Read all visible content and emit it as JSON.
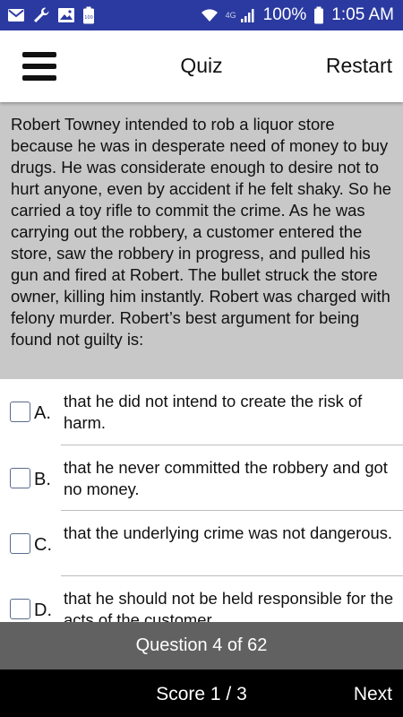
{
  "status_bar": {
    "network_label": "4G",
    "battery": "100%",
    "time": "1:05 AM",
    "icons": [
      "mail-icon",
      "wrench-icon",
      "image-icon",
      "battery-full-icon",
      "wifi-icon",
      "signal-icon",
      "battery-icon"
    ]
  },
  "header": {
    "title": "Quiz",
    "restart_label": "Restart",
    "menu_icon": "hamburger-menu-icon"
  },
  "question": {
    "text": "Robert Towney intended to rob a liquor store because he was in desperate need of money to buy drugs. He was considerate enough to desire not to hurt anyone, even by accident if he felt shaky. So he carried a toy rifle to commit the crime. As he was carrying out the robbery, a customer entered the store, saw the robbery in progress, and pulled his gun and fired at Robert. The bullet struck the store owner, killing him instantly. Robert was charged with felony murder. Robert’s best argument for being found not guilty is:"
  },
  "answers": [
    {
      "letter": "A.",
      "text": "that he did not intend to create the risk of harm.",
      "checked": false
    },
    {
      "letter": "B.",
      "text": "that he never committed the robbery and got no money.",
      "checked": false
    },
    {
      "letter": "C.",
      "text": "that the underlying crime was not dangerous.",
      "checked": false
    },
    {
      "letter": "D.",
      "text": "that he should not be held responsible for the acts of the customer.",
      "checked": false
    }
  ],
  "progress": {
    "label": "Question 4 of 62"
  },
  "footer": {
    "score_label": "Score 1 / 3",
    "next_label": "Next"
  },
  "colors": {
    "status_bar": "#2b3aa0",
    "question_bg": "#c8c8c8",
    "progress_bg": "#616161",
    "footer_bg": "#000000"
  }
}
